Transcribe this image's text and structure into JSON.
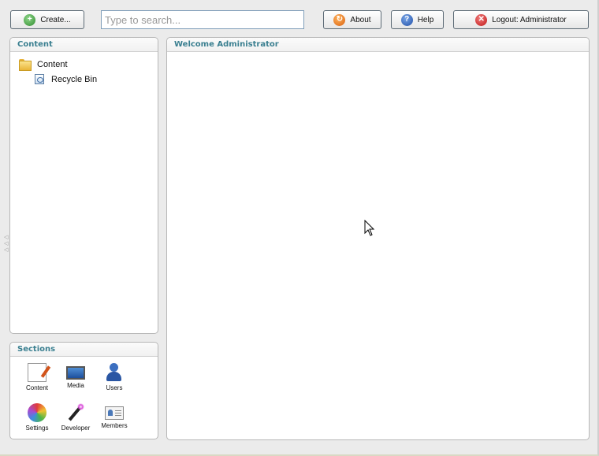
{
  "toolbar": {
    "create_label": "Create...",
    "search_placeholder": "Type to search...",
    "about_label": "About",
    "help_label": "Help",
    "logout_label": "Logout: Administrator"
  },
  "content_panel": {
    "title": "Content",
    "tree": [
      {
        "label": "Content",
        "icon": "folder-icon"
      },
      {
        "label": "Recycle Bin",
        "icon": "recycle-bin-icon"
      }
    ]
  },
  "sections_panel": {
    "title": "Sections",
    "items": [
      {
        "label": "Content",
        "icon": "content-section-icon"
      },
      {
        "label": "Media",
        "icon": "media-section-icon"
      },
      {
        "label": "Users",
        "icon": "users-section-icon"
      },
      {
        "label": "Settings",
        "icon": "settings-section-icon"
      },
      {
        "label": "Developer",
        "icon": "developer-section-icon"
      },
      {
        "label": "Members",
        "icon": "members-section-icon"
      }
    ]
  },
  "main_panel": {
    "title": "Welcome Administrator"
  }
}
